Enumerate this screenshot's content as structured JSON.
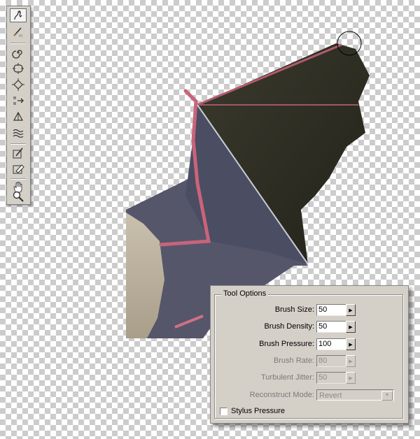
{
  "toolbar": {
    "tools": [
      {
        "name": "warp-tool-icon",
        "active": true
      },
      {
        "name": "reconstruct-tool-icon",
        "active": false
      },
      {
        "name": "twirl-clockwise-tool-icon",
        "active": false
      },
      {
        "name": "pucker-tool-icon",
        "active": false
      },
      {
        "name": "bloat-tool-icon",
        "active": false
      },
      {
        "name": "shift-pixels-tool-icon",
        "active": false
      },
      {
        "name": "reflection-tool-icon",
        "active": false
      },
      {
        "name": "turbulence-tool-icon",
        "active": false
      },
      {
        "name": "freeze-mask-tool-icon",
        "active": false
      },
      {
        "name": "thaw-mask-tool-icon",
        "active": false
      },
      {
        "name": "hand-tool-icon",
        "active": false
      },
      {
        "name": "zoom-tool-icon",
        "active": false
      }
    ]
  },
  "tool_options": {
    "title": "Tool Options",
    "brush_size": {
      "label": "Brush Size:",
      "value": "50",
      "enabled": true
    },
    "brush_density": {
      "label": "Brush Density:",
      "value": "50",
      "enabled": true
    },
    "brush_pressure": {
      "label": "Brush Pressure:",
      "value": "100",
      "enabled": true
    },
    "brush_rate": {
      "label": "Brush Rate:",
      "value": "80",
      "enabled": false
    },
    "turbulent_jitter": {
      "label": "Turbulent Jitter:",
      "value": "50",
      "enabled": false
    },
    "reconstruct_mode": {
      "label": "Reconstruct Mode:",
      "value": "Revert",
      "enabled": false
    },
    "stylus_pressure": {
      "label": "Stylus Pressure",
      "checked": false
    }
  },
  "colors": {
    "panel_bg": "#d4d0c8",
    "wing_membrane": "#2f2e22",
    "wing_bone": "#c8647a"
  }
}
